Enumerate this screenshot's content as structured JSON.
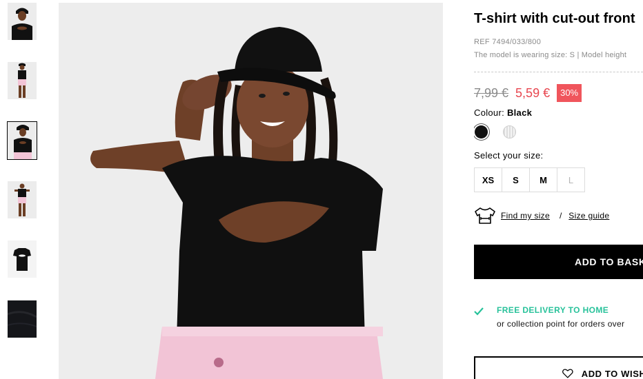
{
  "thumbnails": [
    {
      "name": "thumb-closeup",
      "active": false
    },
    {
      "name": "thumb-fullbody-1",
      "active": false
    },
    {
      "name": "thumb-portrait",
      "active": true
    },
    {
      "name": "thumb-fullbody-2",
      "active": false
    },
    {
      "name": "thumb-flatlay",
      "active": false
    },
    {
      "name": "thumb-fabric",
      "active": false
    }
  ],
  "product": {
    "title": "T-shirt with cut-out front",
    "ref": "REF 7494/033/800",
    "model_info": "The model is wearing size: S | Model height",
    "price_old": "7,99 €",
    "price_new": "5,59 €",
    "discount": "30%",
    "colour_label": "Colour:",
    "colour_value": "Black",
    "colours": [
      {
        "name": "Black",
        "hex": "#111111",
        "selected": true
      },
      {
        "name": "White",
        "hex": "#eeeeee",
        "selected": false
      }
    ],
    "size_label": "Select your size:",
    "sizes": [
      {
        "label": "XS",
        "available": true
      },
      {
        "label": "S",
        "available": true
      },
      {
        "label": "M",
        "available": true
      },
      {
        "label": "L",
        "available": false
      }
    ],
    "find_my_size": "Find my size",
    "separator": "/",
    "size_guide": "Size guide",
    "add_to_basket": "ADD TO BASKE",
    "delivery_title": "FREE DELIVERY TO HOME",
    "delivery_sub": "or collection point for orders over",
    "add_to_wishlist": "ADD TO WISHL"
  },
  "colors": {
    "accent_green": "#27c29a",
    "sale_red": "#e8464f",
    "badge_red": "#f0555c",
    "text_grey": "#8a8a8a"
  }
}
